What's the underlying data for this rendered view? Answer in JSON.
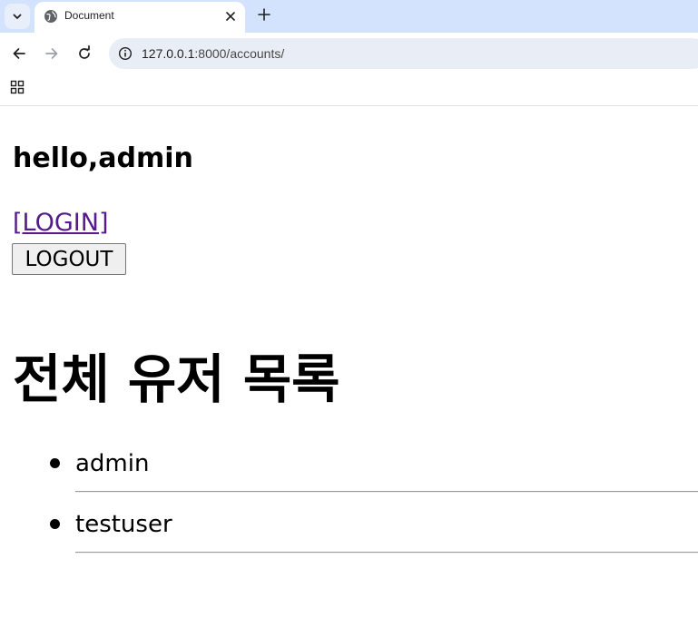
{
  "browser": {
    "tab_title": "Document",
    "url_host": "127.0.0.1",
    "url_rest": ":8000/accounts/"
  },
  "page": {
    "greeting": "hello,admin",
    "login_link": "[LOGIN]",
    "logout_button": "LOGOUT",
    "users_heading": "전체 유저 목록",
    "users": [
      {
        "username": "admin"
      },
      {
        "username": "testuser"
      }
    ]
  }
}
